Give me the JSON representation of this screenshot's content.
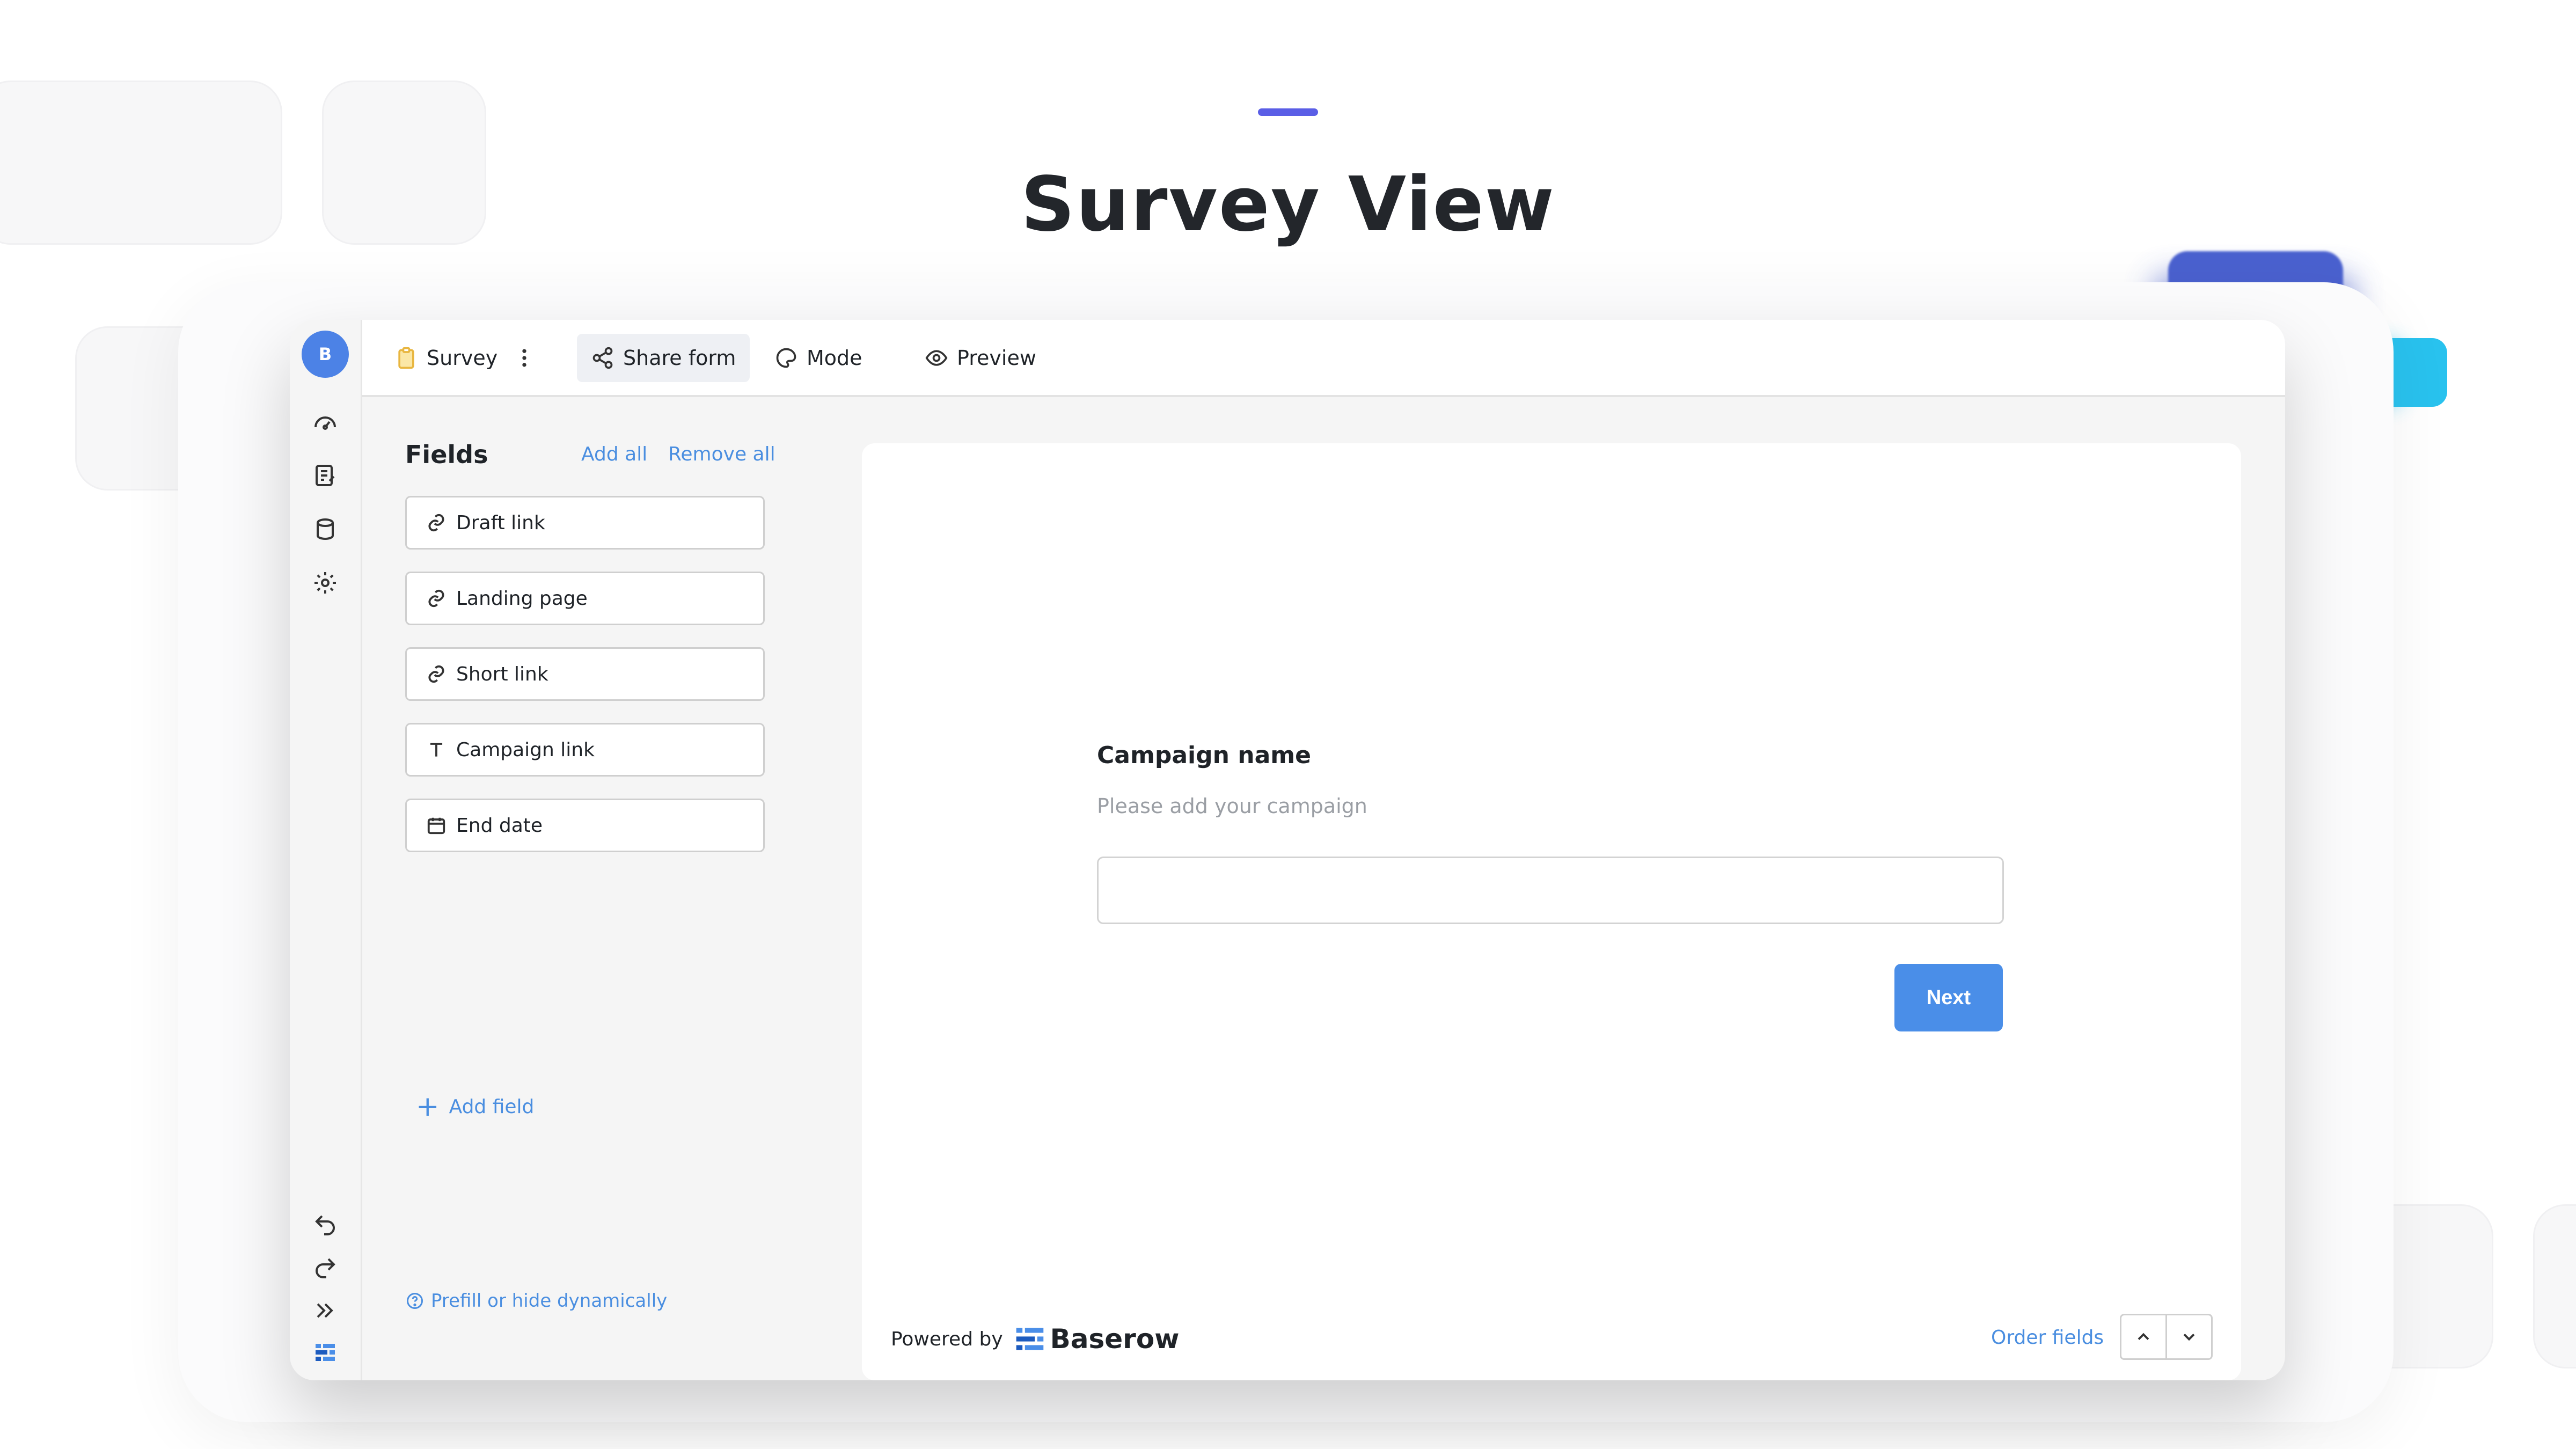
{
  "page": {
    "title": "Survey View"
  },
  "sidebar": {
    "avatar_letter": "B",
    "icons": [
      "dashboard-icon",
      "notes-icon",
      "database-icon",
      "settings-icon",
      "undo-icon",
      "redo-icon",
      "expand-icon",
      "baserow-logo-icon"
    ]
  },
  "topbar": {
    "view_name": "Survey",
    "share_label": "Share form",
    "mode_label": "Mode",
    "preview_label": "Preview"
  },
  "fields_panel": {
    "title": "Fields",
    "add_all": "Add all",
    "remove_all": "Remove all",
    "fields": [
      {
        "label": "Draft link",
        "icon": "link-icon"
      },
      {
        "label": "Landing page",
        "icon": "link-icon"
      },
      {
        "label": "Short link",
        "icon": "link-icon"
      },
      {
        "label": "Campaign link",
        "icon": "text-icon"
      },
      {
        "label": "End date",
        "icon": "calendar-icon"
      }
    ],
    "add_field": "Add field",
    "prefill_link": "Prefill or hide dynamically"
  },
  "form": {
    "question_title": "Campaign name",
    "question_description": "Please add your campaign",
    "input_value": "",
    "next_label": "Next",
    "powered_by": "Powered by",
    "brand_name": "Baserow",
    "order_fields": "Order fields"
  },
  "colors": {
    "accent_blue": "#4a8ee8",
    "link_blue": "#4a8ee0",
    "avatar_blue": "#4c82e6"
  }
}
